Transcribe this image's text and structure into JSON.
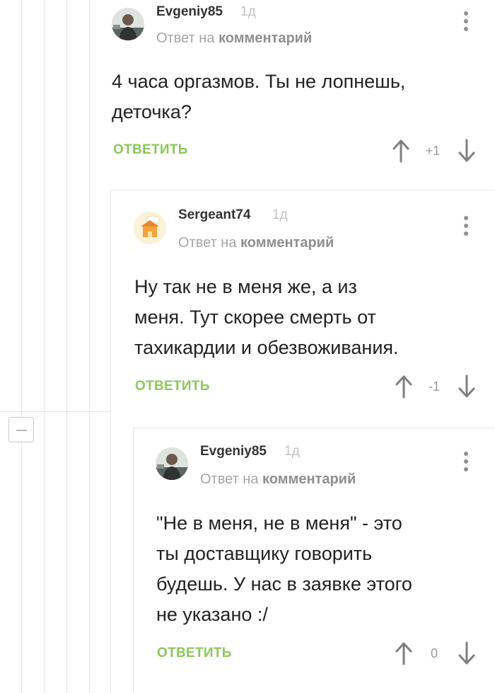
{
  "comments": [
    {
      "author": "Evgeniy85",
      "time": "1д",
      "reply_prefix": "Ответ на",
      "reply_target": "комментарий",
      "text_lines": [
        "4 часа оргазмов. Ты не лопнешь,",
        "деточка?"
      ],
      "reply_label": "ОТВЕТИТЬ",
      "score": "+1",
      "avatar_icon": "user-photo-avatar"
    },
    {
      "author": "Sergeant74",
      "time": "1д",
      "reply_prefix": "Ответ на",
      "reply_target": "комментарий",
      "text_lines": [
        "Ну так не в меня же, а из",
        "меня. Тут скорее смерть от",
        "тахикардии и обезвоживания."
      ],
      "reply_label": "ОТВЕТИТЬ",
      "score": "-1",
      "avatar_icon": "cartoon-house-avatar"
    },
    {
      "author": "Evgeniy85",
      "time": "1д",
      "reply_prefix": "Ответ на",
      "reply_target": "комментарий",
      "text_lines": [
        "\"Не в меня, не в меня\" - это",
        "ты доставщику говорить",
        "будешь. У нас в заявке этого",
        "не указано :/"
      ],
      "reply_label": "ОТВЕТИТЬ",
      "score": "0",
      "avatar_icon": "user-photo-avatar"
    }
  ],
  "icons": {
    "collapse": "minus-icon",
    "menu": "more-vertical-icon",
    "upvote": "arrow-up-icon",
    "downvote": "arrow-down-icon"
  },
  "colors": {
    "reply_green": "#8ac858",
    "thread_line": "#e6e6e6",
    "muted_text": "#a6a6a6"
  }
}
